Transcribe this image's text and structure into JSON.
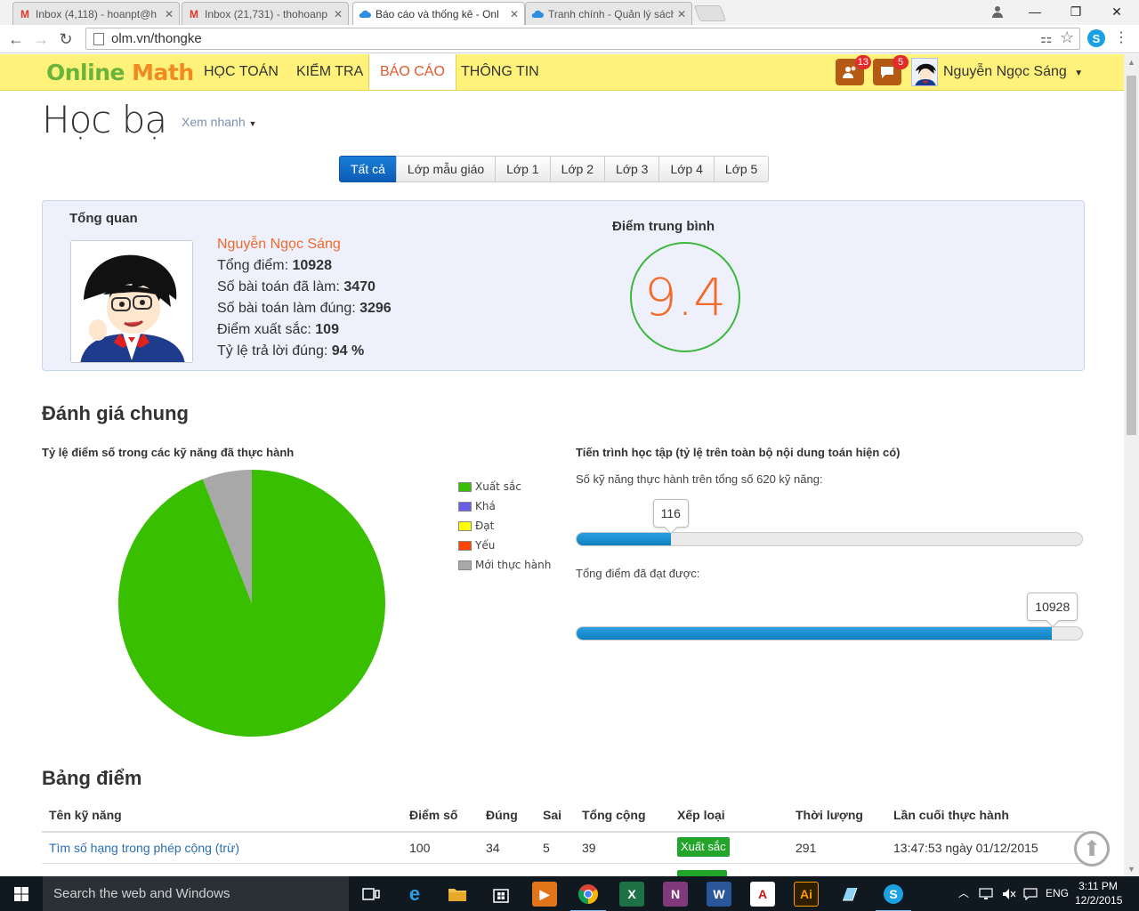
{
  "browser": {
    "tabs": [
      {
        "title": "Inbox (4,118) - hoanpt@h",
        "icon": "gmail-icon"
      },
      {
        "title": "Inbox (21,731) - thohoanp",
        "icon": "gmail-icon"
      },
      {
        "title": "Báo cáo và thống kê - Onl",
        "icon": "cloud-icon",
        "active": true
      },
      {
        "title": "Tranh chính - Quản lý sách",
        "icon": "cloud-icon"
      }
    ],
    "url": "olm.vn/thongke"
  },
  "site": {
    "logo": {
      "w1": "Online",
      "w2": "Math"
    },
    "nav": [
      "HỌC TOÁN",
      "KIỂM TRA",
      "BÁO CÁO",
      "THÔNG TIN"
    ],
    "active_nav": "BÁO CÁO",
    "friend_badge": "13",
    "message_badge": "5",
    "username": "Nguyễn Ngọc Sáng"
  },
  "page": {
    "title": "Học bạ",
    "quick_view": "Xem nhanh",
    "grade_tabs": [
      "Tất cả",
      "Lớp mẫu giáo",
      "Lớp 1",
      "Lớp 2",
      "Lớp 3",
      "Lớp 4",
      "Lớp 5"
    ],
    "active_grade_tab": "Tất cả"
  },
  "overview": {
    "heading": "Tổng quan",
    "name": "Nguyễn Ngọc Sáng",
    "stats": [
      {
        "label": "Tổng điểm: ",
        "value": "10928"
      },
      {
        "label": "Số bài toán đã làm: ",
        "value": "3470"
      },
      {
        "label": "Số bài toán làm đúng: ",
        "value": "3296"
      },
      {
        "label": "Điểm xuất sắc: ",
        "value": "109"
      },
      {
        "label": "Tỷ lệ trả lời đúng: ",
        "value": "94 %"
      }
    ],
    "avg_label": "Điểm trung bình",
    "avg_value": "9.4"
  },
  "assessment": {
    "heading": "Đánh giá chung",
    "pie_title": "Tỷ lệ điểm số trong các kỹ năng đã thực hành",
    "progress_title": "Tiến trình học tập (tỷ lệ trên toàn bộ nội dung toán hiện có)",
    "skills_label": "Số kỹ năng thực hành trên tổng số 620 kỹ năng:",
    "skills_value": "116",
    "skills_fraction": 0.187,
    "points_label": "Tổng điểm đã đạt được:",
    "points_value": "10928",
    "points_fraction": 0.94
  },
  "chart_data": {
    "type": "pie",
    "title": "Tỷ lệ điểm số trong các kỹ năng đã thực hành",
    "categories": [
      "Xuất sắc",
      "Khá",
      "Đạt",
      "Yếu",
      "Mới thực hành"
    ],
    "values": [
      94,
      0,
      0,
      0,
      6
    ],
    "colors": [
      "#38bf00",
      "#6a5ee6",
      "#ffff00",
      "#ff4400",
      "#a8a8a8"
    ],
    "legend": "right"
  },
  "table": {
    "heading": "Bảng điểm",
    "columns": [
      "Tên kỹ năng",
      "Điểm số",
      "Đúng",
      "Sai",
      "Tổng cộng",
      "Xếp loại",
      "Thời lượng",
      "Lần cuối thực hành"
    ],
    "rows": [
      {
        "skill": "Tìm số hạng trong phép cộng (trừ)",
        "score": "100",
        "correct": "34",
        "wrong": "5",
        "total": "39",
        "rank": "Xuất sắc",
        "duration": "291",
        "last": "13:47:53 ngày 01/12/2015"
      }
    ]
  },
  "taskbar": {
    "search_placeholder": "Search the web and Windows",
    "lang": "ENG",
    "time": "3:11 PM",
    "date": "12/2/2015"
  }
}
